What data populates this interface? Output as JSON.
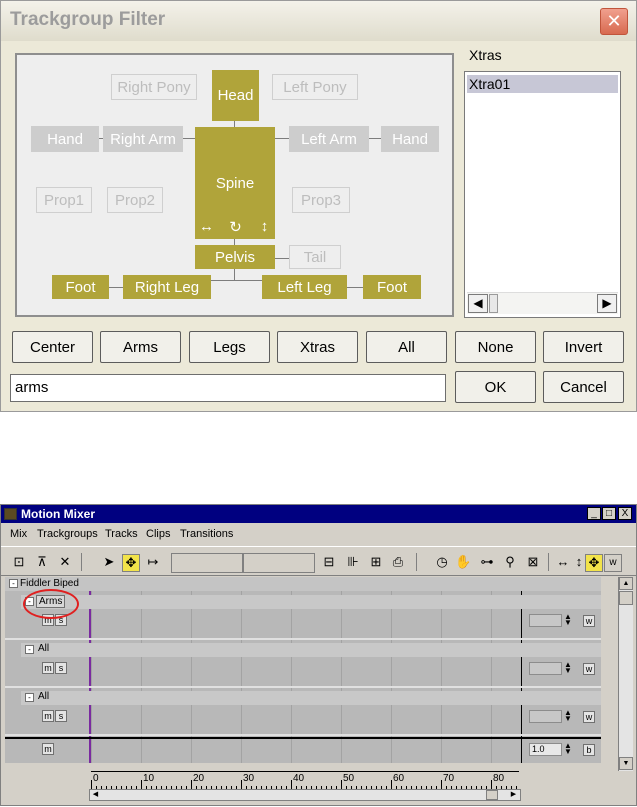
{
  "trackgroup_filter": {
    "title": "Trackgroup Filter",
    "close_glyph": "✕",
    "body_parts": {
      "head": "Head",
      "spine": "Spine",
      "pelvis": "Pelvis",
      "right_arm": "Right Arm",
      "left_arm": "Left Arm",
      "hand_right": "Hand",
      "hand_left": "Hand",
      "right_pony": "Right Pony",
      "left_pony": "Left Pony",
      "prop1": "Prop1",
      "prop2": "Prop2",
      "prop3": "Prop3",
      "tail": "Tail",
      "right_leg": "Right Leg",
      "left_leg": "Left Leg",
      "foot_right": "Foot",
      "foot_left": "Foot",
      "icon_move": "↔",
      "icon_rotate": "↻",
      "icon_vertical": "↕"
    },
    "xtras_label": "Xtras",
    "xtras_items": [
      "Xtra01"
    ],
    "scroll_left": "◀",
    "scroll_right": "▶",
    "buttons": {
      "center": "Center",
      "arms": "Arms",
      "legs": "Legs",
      "xtras": "Xtras",
      "all": "All",
      "none": "None",
      "invert": "Invert",
      "ok": "OK",
      "cancel": "Cancel"
    },
    "name_value": "arms"
  },
  "motion_mixer": {
    "title": "Motion Mixer",
    "window_buttons": {
      "minimize": "_",
      "maximize": "□",
      "close": "X"
    },
    "menu": [
      "Mix",
      "Trackgroups",
      "Tracks",
      "Clips",
      "Transitions"
    ],
    "biped": "Fiddler Biped",
    "track_groups": [
      {
        "name": "Arms"
      },
      {
        "name": "All"
      },
      {
        "name": "All"
      }
    ],
    "mute_label": "m",
    "solo_label": "s",
    "weight_label": "w",
    "bottom_button": "b",
    "bottom_value": "1.0",
    "ruler_ticks": [
      "0",
      "10",
      "20",
      "30",
      "40",
      "50",
      "60",
      "70",
      "80"
    ]
  }
}
